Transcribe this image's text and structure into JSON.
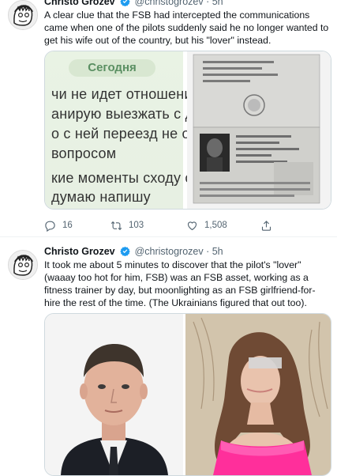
{
  "tweets": [
    {
      "author_name": "Christo Grozev",
      "handle_time": "@christogrozev · 5h",
      "text": "A clear clue that the FSB had intercepted the communications came when one of the pilots suddenly said he no longer wanted to get his wife out of the country, but his \"lover\" instead.",
      "media": {
        "chat_chip": "Сегодня",
        "chat_lines": [
          "чи не идет отношения",
          "анирую выезжать с дру",
          "о с ней переезд не обс",
          "вопросом",
          "кие моменты сходу отв",
          "думаю напишу"
        ]
      },
      "stats": {
        "replies": "16",
        "retweets": "103",
        "likes": "1,508"
      }
    },
    {
      "author_name": "Christo Grozev",
      "handle_time": "@christogrozev · 5h",
      "text": "It took me about 5 minutes to discover that the pilot's \"lover\" (waaay too hot for him, FSB) was an FSB asset, working as a fitness trainer by day, but moonlighting as an FSB girlfriend-for-hire the rest of the time. (The Ukrainians figured that out too)."
    }
  ],
  "icons": {
    "verified": "verified-badge-icon",
    "reply": "reply-icon",
    "retweet": "retweet-icon",
    "like": "heart-icon",
    "share": "share-icon"
  },
  "colors": {
    "verified": "#1d9bf0",
    "muted": "#536471",
    "text": "#0f1419",
    "border": "#cfd9de"
  }
}
